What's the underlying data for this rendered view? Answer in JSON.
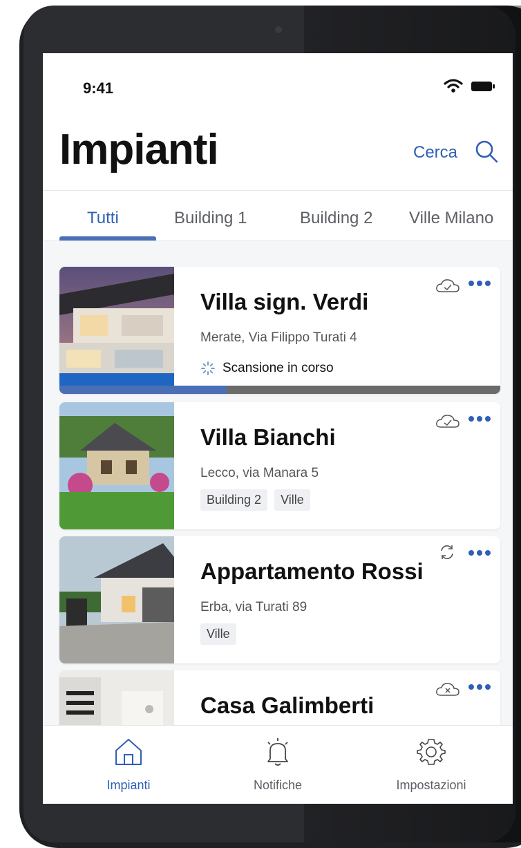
{
  "status_bar": {
    "time": "9:41"
  },
  "header": {
    "title": "Impianti",
    "search_label": "Cerca"
  },
  "tabs": [
    {
      "label": "Tutti",
      "active": true
    },
    {
      "label": "Building 1",
      "active": false
    },
    {
      "label": "Building 2",
      "active": false
    },
    {
      "label": "Ville Milano",
      "active": false
    }
  ],
  "cards": [
    {
      "title": "Villa sign. Verdi",
      "address": "Merate, Via Filippo Turati 4",
      "status": "Scansione in corso",
      "progress": 0.38,
      "sync_icon": "cloud-check-icon"
    },
    {
      "title": "Villa Bianchi",
      "address": "Lecco, via Manara 5",
      "tags": [
        "Building 2",
        "Ville"
      ],
      "sync_icon": "cloud-check-icon"
    },
    {
      "title": "Appartamento Rossi",
      "address": "Erba, via Turati 89",
      "tags": [
        "Ville"
      ],
      "sync_icon": "sync-icon"
    },
    {
      "title": "Casa Galimberti",
      "sync_icon": "cloud-error-icon"
    }
  ],
  "tab_bar": [
    {
      "label": "Impianti",
      "icon": "home-icon",
      "active": true
    },
    {
      "label": "Notifiche",
      "icon": "bell-icon",
      "active": false
    },
    {
      "label": "Impostazioni",
      "icon": "gear-icon",
      "active": false
    }
  ],
  "colors": {
    "accent": "#2f5fb6",
    "progress_fill": "#4a6fb5",
    "progress_track": "#6b6b6b"
  }
}
